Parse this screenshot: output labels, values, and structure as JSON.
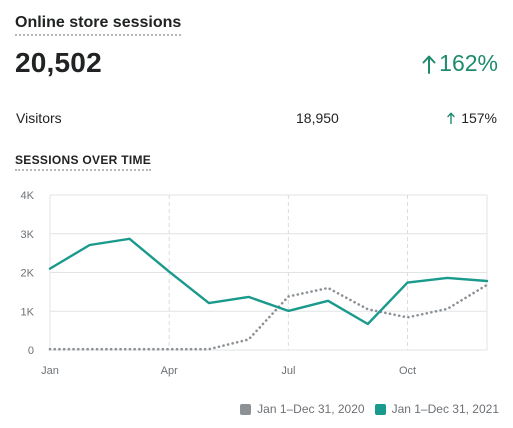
{
  "card": {
    "title": "Online store sessions",
    "total": "20,502",
    "total_change": "162%",
    "positive_color": "#1f8a6c"
  },
  "visitors": {
    "label": "Visitors",
    "value": "18,950",
    "change": "157%"
  },
  "chart_heading": "SESSIONS OVER TIME",
  "icons": {
    "change_up": "arrow-up-icon"
  },
  "chart_data": {
    "type": "line",
    "ylim": [
      0,
      4000
    ],
    "yticks": [
      0,
      1000,
      2000,
      3000,
      4000
    ],
    "ytick_labels": [
      "0",
      "1K",
      "2K",
      "3K",
      "4K"
    ],
    "xlim": [
      1,
      12
    ],
    "xticks": [
      1,
      4,
      7,
      10
    ],
    "xtick_labels": [
      "Jan",
      "Apr",
      "Jul",
      "Oct"
    ],
    "grid": true,
    "legend_position": "bottom-right",
    "series": [
      {
        "name": "Jan 1–Dec 31, 2020",
        "color": "#8c9196",
        "style": "dotted",
        "x": [
          1,
          2,
          3,
          4,
          5,
          6,
          7,
          8,
          9,
          10,
          11,
          12
        ],
        "values": [
          20,
          20,
          20,
          20,
          20,
          270,
          1380,
          1600,
          1050,
          840,
          1060,
          1680
        ]
      },
      {
        "name": "Jan 1–Dec 31, 2021",
        "color": "#1a9a8c",
        "style": "solid",
        "x": [
          1,
          2,
          3,
          4,
          5,
          6,
          7,
          8,
          9,
          10,
          11,
          12
        ],
        "values": [
          2100,
          2710,
          2870,
          2020,
          1210,
          1370,
          1010,
          1270,
          670,
          1740,
          1860,
          1780
        ]
      }
    ]
  }
}
